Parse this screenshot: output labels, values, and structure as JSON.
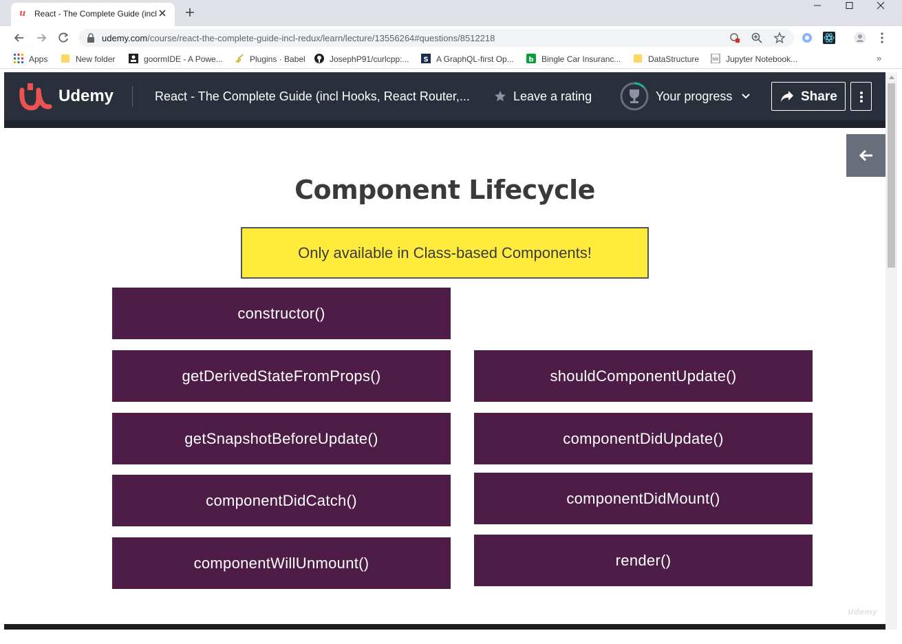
{
  "browser": {
    "tab": {
      "favicon": "udemy-u",
      "title": "React - The Complete Guide (incl"
    },
    "url": {
      "host": "udemy.com",
      "path": "/course/react-the-complete-guide-incl-redux/learn/lecture/13556264#questions/8512218"
    },
    "bookmarks": [
      {
        "label": "Apps",
        "icon": "apps-grid-icon"
      },
      {
        "label": "New folder",
        "icon": "folder-icon"
      },
      {
        "label": "goormIDE - A Powe...",
        "icon": "goorm-icon"
      },
      {
        "label": "Plugins · Babel",
        "icon": "babel-icon"
      },
      {
        "label": "JosephP91/curlcpp:...",
        "icon": "github-icon"
      },
      {
        "label": "A GraphQL-first Op...",
        "icon": "prisma-icon"
      },
      {
        "label": "Bingle Car Insuranc...",
        "icon": "bingle-icon"
      },
      {
        "label": "DataStructure",
        "icon": "folder-icon"
      },
      {
        "label": "Jupyter Notebook...",
        "icon": "jupyter-icon"
      }
    ],
    "bookmarks_more": "»"
  },
  "header": {
    "logo": "Udemy",
    "course_title": "React - The Complete Guide (incl Hooks, React Router,...",
    "rating_label": "Leave a rating",
    "progress_label": "Your progress",
    "share_label": "Share"
  },
  "slide": {
    "title": "Component Lifecycle",
    "callout": "Only available in Class-based Components!",
    "left_methods": [
      "constructor()",
      "getDerivedStateFromProps()",
      "getSnapshotBeforeUpdate()",
      "componentDidCatch()",
      "componentWillUnmount()"
    ],
    "right_methods": [
      "shouldComponentUpdate()",
      "componentDidUpdate()",
      "componentDidMount()",
      "render()"
    ],
    "watermark": "Udemy"
  },
  "colors": {
    "header_bg": "#29303b",
    "method_box": "#4d1c47",
    "callout_bg": "#ffeb3b",
    "brand_red": "#ec5252"
  }
}
